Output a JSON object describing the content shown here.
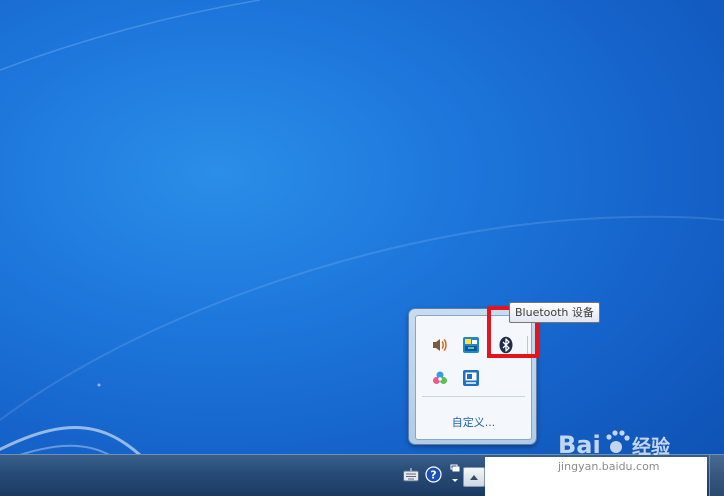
{
  "desktop": {
    "background_color": "#1d76db"
  },
  "tray_popup": {
    "icons": [
      {
        "name": "volume-icon"
      },
      {
        "name": "network-app-icon"
      },
      {
        "name": "bluetooth-icon"
      },
      {
        "name": "color-dots-icon"
      },
      {
        "name": "display-app-icon"
      }
    ],
    "customize_label": "自定义..."
  },
  "tooltip": {
    "text": "Bluetooth 设备"
  },
  "highlight": {
    "color": "#e2141c"
  },
  "taskbar": {
    "icons": [
      "keyboard-icon",
      "help-icon",
      "window-switch-icon",
      "show-hidden-arrow-icon"
    ]
  },
  "watermark": {
    "brand": "Baidu经验",
    "url": "jingyan.baidu.com"
  }
}
